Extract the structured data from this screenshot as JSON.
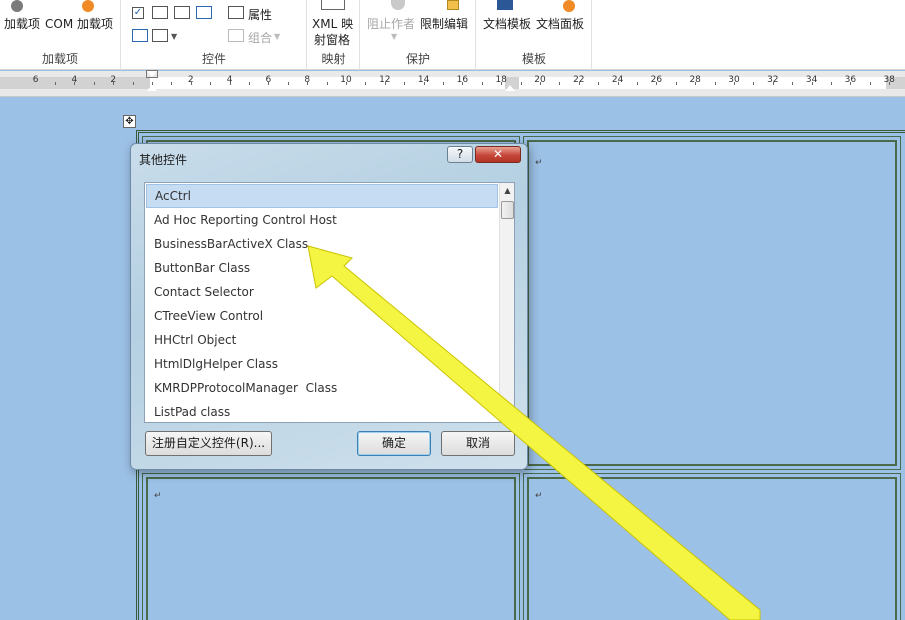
{
  "ribbon": {
    "addins_btn": "加载项",
    "com_addins_btn": "COM 加载项",
    "group_addins": "加载项",
    "properties_btn": "属性",
    "group_btn": "组合",
    "group_controls": "控件",
    "xml_btn_line1": "XML 映",
    "xml_btn_line2": "射窗格",
    "group_mapping": "映射",
    "block_authors_btn": "阻止作者",
    "restrict_editing_btn": "限制编辑",
    "group_protect": "保护",
    "doc_template_btn": "文档模板",
    "doc_panel_btn": "文档面板",
    "group_templates": "模板"
  },
  "ruler": {
    "left_labels": [
      "6",
      "4",
      "2"
    ],
    "right_labels": [
      "2",
      "4",
      "6",
      "8",
      "10",
      "12",
      "14",
      "16",
      "18",
      "20",
      "22",
      "24",
      "26",
      "28",
      "30",
      "32",
      "34",
      "36",
      "38"
    ]
  },
  "document": {
    "move_handle": "✥",
    "para_mark": "↵"
  },
  "dialog": {
    "title": "其他控件",
    "help": "?",
    "close": "✕",
    "items": [
      "AcCtrl",
      "Ad Hoc Reporting Control Host",
      "BusinessBarActiveX Class",
      "ButtonBar Class",
      "Contact Selector",
      "CTreeView Control",
      "HHCtrl Object",
      "HtmlDlgHelper Class",
      "KMRDPProtocolManager  Class",
      "ListPad class"
    ],
    "register_btn": "注册自定义控件(R)...",
    "ok_btn": "确定",
    "cancel_btn": "取消"
  },
  "colors": {
    "page_bg": "#9cc1e6",
    "selection": "#c6dcf2",
    "annotation_arrow": "#f4f542"
  }
}
